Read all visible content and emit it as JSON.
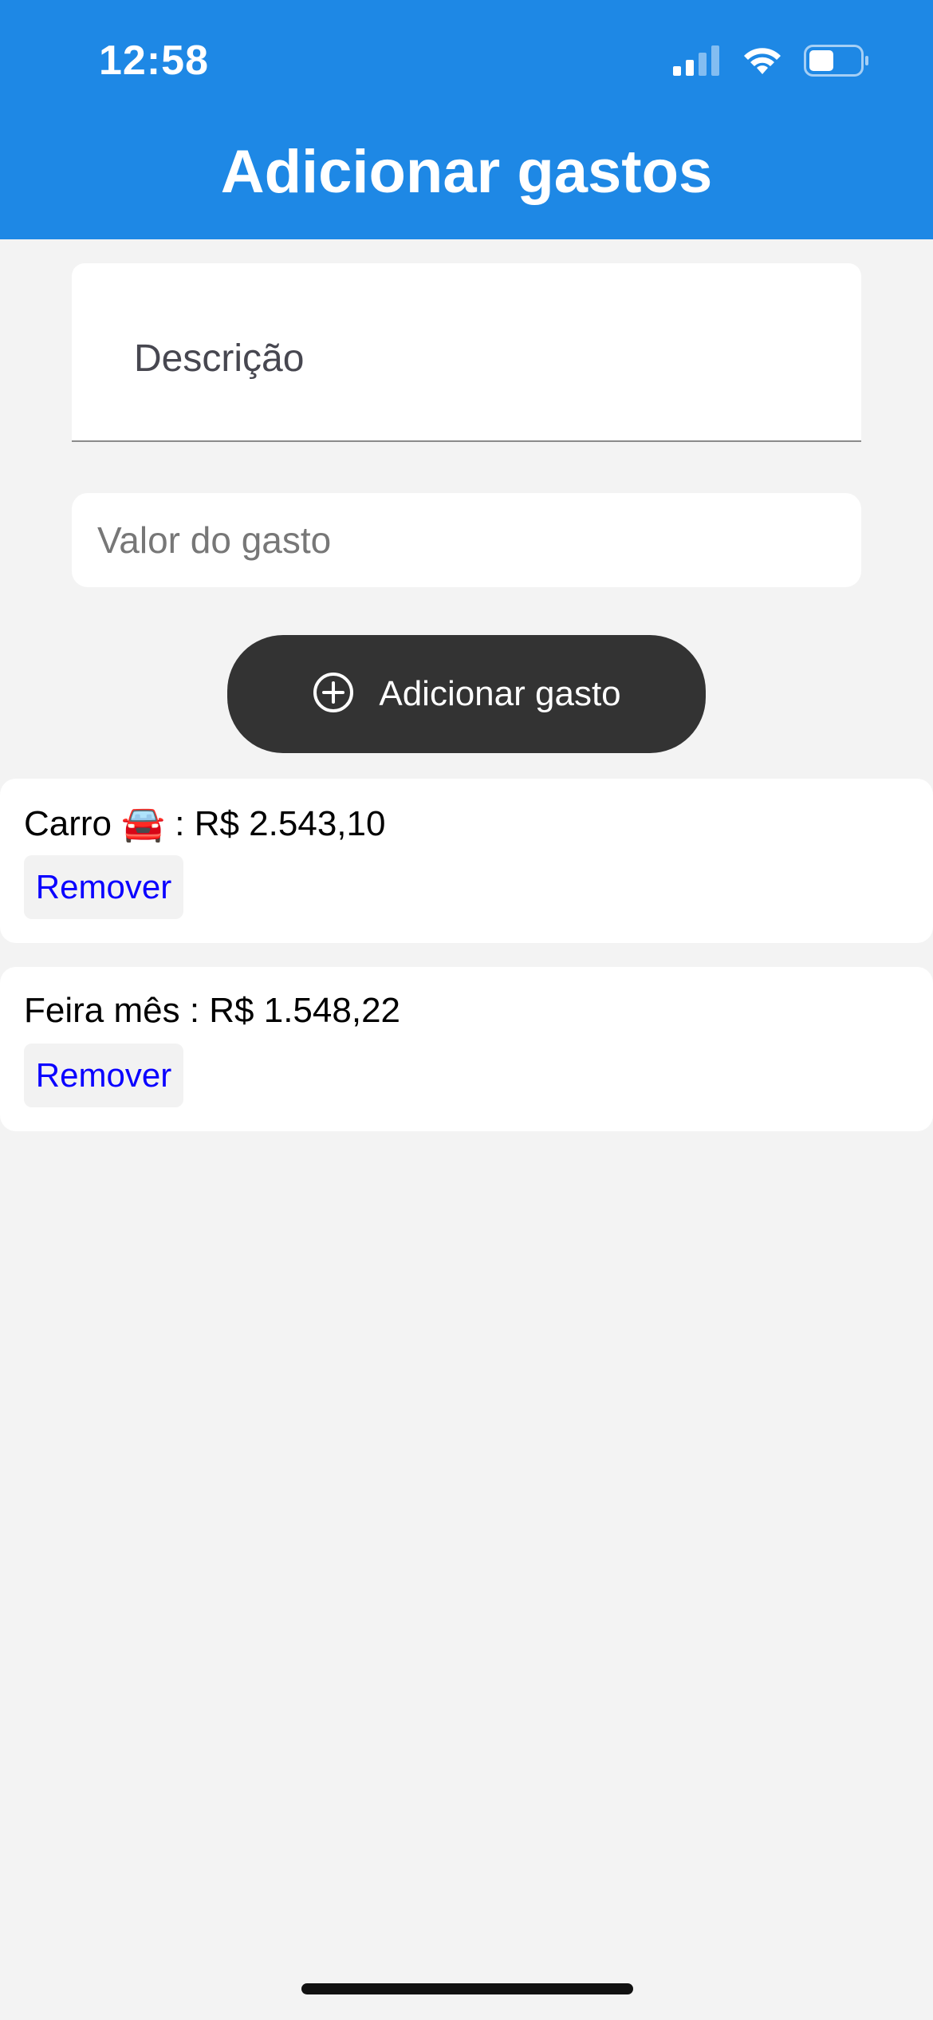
{
  "status_bar": {
    "time": "12:58",
    "icons": [
      "signal-icon",
      "wifi-icon",
      "battery-icon"
    ]
  },
  "header": {
    "title": "Adicionar gastos",
    "background": "#1e88e5"
  },
  "form": {
    "description_label": "Descrição",
    "value_placeholder": "Valor do gasto",
    "add_button_label": "Adicionar gasto",
    "add_button_icon": "plus-circle-icon"
  },
  "expenses": [
    {
      "text": "Carro 🚘 : R$ 2.543,10",
      "remove_label": "Remover"
    },
    {
      "text": "Feira mês : R$ 1.548,22",
      "remove_label": "Remover"
    }
  ],
  "colors": {
    "accent": "#1e88e5",
    "button_dark": "#333333",
    "link_blue": "#0a00ff",
    "background": "#f3f3f3"
  }
}
